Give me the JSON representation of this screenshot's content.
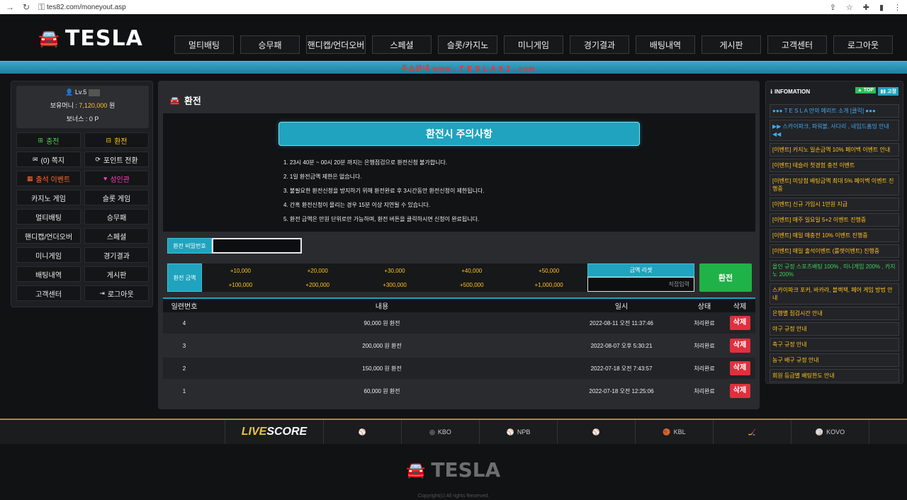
{
  "browser": {
    "url": "tes82.com/moneyout.asp"
  },
  "header": {
    "logo": "TESLA",
    "nav": [
      "멀티배팅",
      "승무패",
      "핸디캡/언더오버",
      "스페셜",
      "슬롯/카지노",
      "미니게임",
      "경기결과",
      "배팅내역",
      "게시판",
      "고객센터",
      "로그아웃"
    ],
    "marquee": "주소안내 www . T E S L A 8 2 . com"
  },
  "user": {
    "level": "Lv.5",
    "money_label": "보유머니 : ",
    "money_value": "7,120,000",
    "money_unit": " 원",
    "bonus": "보너스 : 0 P"
  },
  "left_buttons": [
    {
      "label": "충전",
      "icon": "⊞",
      "cls": "g"
    },
    {
      "label": "환전",
      "icon": "⊟",
      "cls": "y"
    },
    {
      "label": "(0) 쪽지",
      "icon": "✉",
      "cls": ""
    },
    {
      "label": "포인트 전환",
      "icon": "⟳",
      "cls": ""
    },
    {
      "label": "출석 이벤트",
      "icon": "▦",
      "cls": "o"
    },
    {
      "label": "성인관",
      "icon": "♥",
      "cls": "p"
    },
    {
      "label": "카지노 게임",
      "icon": "",
      "cls": ""
    },
    {
      "label": "슬롯 게임",
      "icon": "",
      "cls": ""
    },
    {
      "label": "멀티배팅",
      "icon": "",
      "cls": ""
    },
    {
      "label": "승무패",
      "icon": "",
      "cls": ""
    },
    {
      "label": "핸디캡/언더오버",
      "icon": "",
      "cls": ""
    },
    {
      "label": "스페셜",
      "icon": "",
      "cls": ""
    },
    {
      "label": "미니게임",
      "icon": "",
      "cls": ""
    },
    {
      "label": "경기결과",
      "icon": "",
      "cls": ""
    },
    {
      "label": "배팅내역",
      "icon": "",
      "cls": ""
    },
    {
      "label": "게시판",
      "icon": "",
      "cls": ""
    },
    {
      "label": "고객센터",
      "icon": "",
      "cls": ""
    },
    {
      "label": "로그아웃",
      "icon": "⇥",
      "cls": ""
    }
  ],
  "main": {
    "title": "환전",
    "notice_title": "환전시 주의사항",
    "notices": [
      "1. 23시 40분 ~ 00시 20분 까지는 은행점검으로 환전신청 불가합니다.",
      "2. 1일 환전금액 제한은 없습니다.",
      "3. 불필요한 환전신청을 방지하기 위해 환전완료 후 3시간동안 환전신청이 제한됩니다.",
      "4. 간혹 환전신청이 몰리는 경우 15분 이상 지연될 수 있습니다.",
      "5. 환전 금액은 만원 단위로만 가능하며, 환전 버튼을 클릭하시면 신청이 완료됩니다."
    ],
    "password_label": "환전 비밀번호",
    "amount_label": "환전 금액",
    "amounts": [
      "+10,000",
      "+20,000",
      "+30,000",
      "+40,000",
      "+50,000",
      "+100,000",
      "+200,000",
      "+300,000",
      "+500,000",
      "+1,000,000"
    ],
    "reset_label": "금액 리셋",
    "direct_placeholder": "직접입력",
    "submit_label": "환전",
    "table_headers": [
      "일련번호",
      "내용",
      "일시",
      "상태",
      "삭제"
    ],
    "rows": [
      {
        "no": "4",
        "content": "90,000 원 환전",
        "date": "2022-08-11 오전 11:37:46",
        "status": "처리완료",
        "del": "삭제"
      },
      {
        "no": "3",
        "content": "200,000 원 환전",
        "date": "2022-08-07 오후 5:30:21",
        "status": "처리완료",
        "del": "삭제"
      },
      {
        "no": "2",
        "content": "150,000 원 환전",
        "date": "2022-07-18 오전 7:43:57",
        "status": "처리완료",
        "del": "삭제"
      },
      {
        "no": "1",
        "content": "60,000 원 환전",
        "date": "2022-07-18 오전 12:25:06",
        "status": "처리완료",
        "del": "삭제"
      }
    ]
  },
  "info": {
    "title": "INFOMATION",
    "top_label": "▲ TOP",
    "fix_label": "▮▮ 고정",
    "items": [
      {
        "text": "●●● T E S L A 만의 메리트 소개 [클릭] ●●●",
        "cls": "blue"
      },
      {
        "text": "▶▶ 스카이파크, 파워볼, 사다리 , 네임드홈밍 안내 ◀◀",
        "cls": "blue"
      },
      {
        "text": "[이벤트] 카지노 일손금액 10% 페이백 이벤트 안내",
        "cls": ""
      },
      {
        "text": "[이벤트] 테슬라 첫경험 충전 이벤트",
        "cls": ""
      },
      {
        "text": "[이벤트] 미당첨 배팅금액 최대 5% 페이백 이벤트 진행중",
        "cls": ""
      },
      {
        "text": "[이벤트] 신규 가입시 1만원 지급",
        "cls": ""
      },
      {
        "text": "[이벤트] 매주 일요일 5+2 이벤트 진행중",
        "cls": ""
      },
      {
        "text": "[이벤트] 매일 매충전 10% 이벤트 진행중",
        "cls": ""
      },
      {
        "text": "[이벤트] 매일 출석이벤트 (룰렛이벤트) 진행중",
        "cls": ""
      },
      {
        "text": "올인 규정 스포츠배팅 100% , 미니게임 200% , 카지노 200%",
        "cls": "green"
      },
      {
        "text": "스카이파크 포커, 바카라, 블랙잭, 페어 게임 방법 안내",
        "cls": ""
      },
      {
        "text": "은행별 점검시간 안내",
        "cls": ""
      },
      {
        "text": "야구 규정 안내",
        "cls": ""
      },
      {
        "text": "축구 규정 안내",
        "cls": ""
      },
      {
        "text": "농구 배구 규정 안내",
        "cls": ""
      },
      {
        "text": "회원 등급별 배팅한도 안내",
        "cls": ""
      }
    ]
  },
  "footer": {
    "live_a": "LIVE",
    "live_b": "SCORE",
    "leagues": [
      "",
      "KBO",
      "NPB",
      "",
      "KBL",
      "",
      "KOVO"
    ],
    "logo": "TESLA",
    "copyright": "Copyright(c) All rights Reserved."
  }
}
